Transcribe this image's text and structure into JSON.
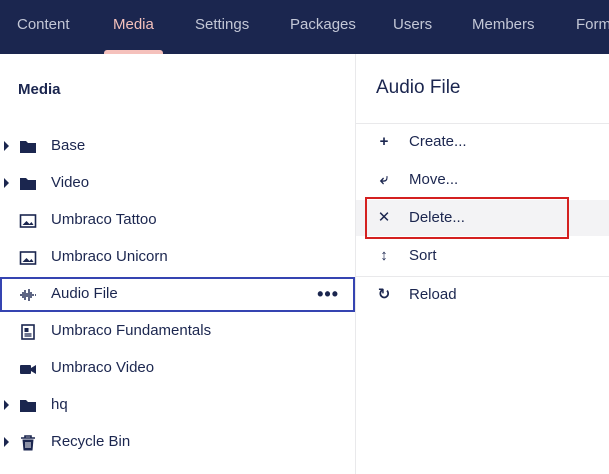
{
  "nav": {
    "tabs": [
      {
        "label": "Content"
      },
      {
        "label": "Media"
      },
      {
        "label": "Settings"
      },
      {
        "label": "Packages"
      },
      {
        "label": "Users"
      },
      {
        "label": "Members"
      },
      {
        "label": "Form"
      }
    ],
    "active_tab": "Media"
  },
  "tree": {
    "title": "Media",
    "items": [
      {
        "label": "Base",
        "icon": "folder-icon",
        "expandable": true
      },
      {
        "label": "Video",
        "icon": "folder-icon",
        "expandable": true
      },
      {
        "label": "Umbraco Tattoo",
        "icon": "image-icon",
        "expandable": false
      },
      {
        "label": "Umbraco Unicorn",
        "icon": "image-icon",
        "expandable": false
      },
      {
        "label": "Audio File",
        "icon": "audio-wave-icon",
        "expandable": false,
        "selected": true,
        "menu": "•••"
      },
      {
        "label": "Umbraco Fundamentals",
        "icon": "document-icon",
        "expandable": false
      },
      {
        "label": "Umbraco Video",
        "icon": "video-camera-icon",
        "expandable": false
      },
      {
        "label": "hq",
        "icon": "folder-icon",
        "expandable": true
      },
      {
        "label": "Recycle Bin",
        "icon": "trash-icon",
        "expandable": true
      }
    ]
  },
  "actions": {
    "title": "Audio File",
    "items": [
      {
        "label": "Create...",
        "icon": "plus-icon",
        "glyph": "+"
      },
      {
        "label": "Move...",
        "icon": "move-icon",
        "glyph": "⤶"
      },
      {
        "label": "Delete...",
        "icon": "delete-x-icon",
        "glyph": "✕",
        "hovered": true,
        "highlighted": true
      },
      {
        "label": "Sort",
        "icon": "sort-arrows-icon",
        "glyph": "↕"
      },
      {
        "label": "Reload",
        "icon": "reload-icon",
        "glyph": "↻"
      }
    ]
  },
  "colors": {
    "nav_bg": "#1b264f",
    "nav_text": "#c3c7d6",
    "nav_active": "#f5c1bc",
    "text": "#1b264f",
    "selection_border": "#3544b1",
    "highlight_box": "#d42020",
    "hover_bg": "#f3f3f5"
  }
}
